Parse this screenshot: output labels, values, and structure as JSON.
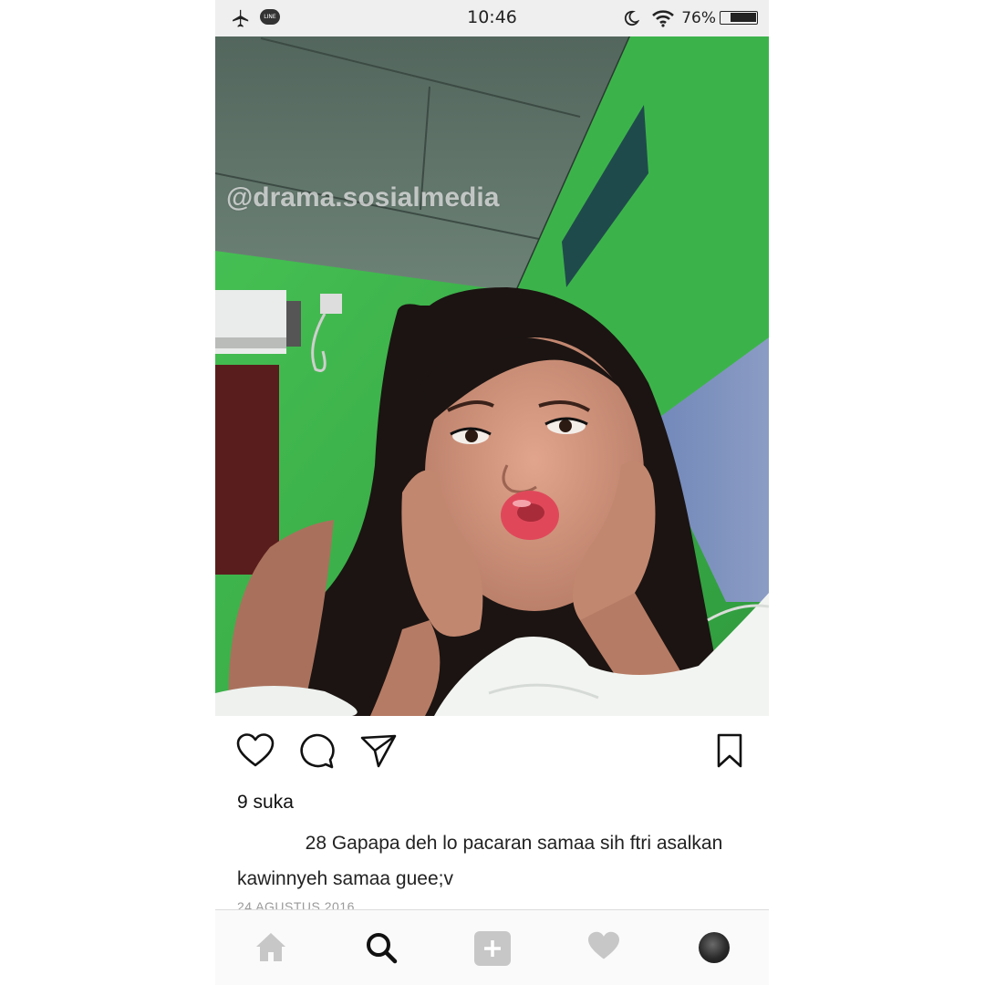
{
  "status_bar": {
    "time": "10:46",
    "battery_percent": "76%",
    "battery_level": 0.76,
    "icons": [
      "airplane-mode-icon",
      "line-app-icon",
      "moon-icon",
      "wifi-icon",
      "battery-icon"
    ],
    "line_badge": "LINE"
  },
  "post": {
    "watermark": "@drama.sosialmedia",
    "likes": "9 suka",
    "caption_user_visible": "28",
    "caption_text": " Gapapa deh lo pacaran samaa sih ftri asalkan kawinnyeh samaa guee;v",
    "date": "24 AGUSTUS 2016",
    "actions": [
      "heart-icon",
      "comment-icon",
      "share-icon",
      "bookmark-icon"
    ]
  },
  "bottom_nav": {
    "items": [
      "home-icon",
      "search-icon",
      "add-post-icon",
      "activity-heart-icon",
      "profile-avatar"
    ],
    "active": "search-icon"
  },
  "colors": {
    "wall_green": "#3fb84a",
    "ceiling": "#5f7268",
    "nav_inactive": "#c7c7c7",
    "nav_active": "#111111"
  }
}
